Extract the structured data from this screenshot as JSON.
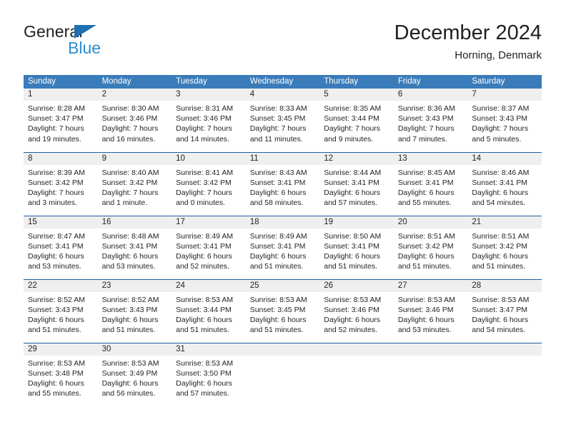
{
  "brand": {
    "line1": "General",
    "line2": "Blue",
    "accent_color": "#2d8ed0",
    "triangle_color": "#1f6fb2"
  },
  "header": {
    "title": "December 2024",
    "location": "Horning, Denmark"
  },
  "theme": {
    "header_blue": "#3a7cba",
    "row_divider_blue": "#1a5fa0",
    "daynum_band": "#efefef",
    "text": "#231f20"
  },
  "calendar": {
    "weekday_headers": [
      "Sunday",
      "Monday",
      "Tuesday",
      "Wednesday",
      "Thursday",
      "Friday",
      "Saturday"
    ],
    "weeks": [
      [
        {
          "day": "1",
          "lines": [
            "Sunrise: 8:28 AM",
            "Sunset: 3:47 PM",
            "Daylight: 7 hours",
            "and 19 minutes."
          ]
        },
        {
          "day": "2",
          "lines": [
            "Sunrise: 8:30 AM",
            "Sunset: 3:46 PM",
            "Daylight: 7 hours",
            "and 16 minutes."
          ]
        },
        {
          "day": "3",
          "lines": [
            "Sunrise: 8:31 AM",
            "Sunset: 3:46 PM",
            "Daylight: 7 hours",
            "and 14 minutes."
          ]
        },
        {
          "day": "4",
          "lines": [
            "Sunrise: 8:33 AM",
            "Sunset: 3:45 PM",
            "Daylight: 7 hours",
            "and 11 minutes."
          ]
        },
        {
          "day": "5",
          "lines": [
            "Sunrise: 8:35 AM",
            "Sunset: 3:44 PM",
            "Daylight: 7 hours",
            "and 9 minutes."
          ]
        },
        {
          "day": "6",
          "lines": [
            "Sunrise: 8:36 AM",
            "Sunset: 3:43 PM",
            "Daylight: 7 hours",
            "and 7 minutes."
          ]
        },
        {
          "day": "7",
          "lines": [
            "Sunrise: 8:37 AM",
            "Sunset: 3:43 PM",
            "Daylight: 7 hours",
            "and 5 minutes."
          ]
        }
      ],
      [
        {
          "day": "8",
          "lines": [
            "Sunrise: 8:39 AM",
            "Sunset: 3:42 PM",
            "Daylight: 7 hours",
            "and 3 minutes."
          ]
        },
        {
          "day": "9",
          "lines": [
            "Sunrise: 8:40 AM",
            "Sunset: 3:42 PM",
            "Daylight: 7 hours",
            "and 1 minute."
          ]
        },
        {
          "day": "10",
          "lines": [
            "Sunrise: 8:41 AM",
            "Sunset: 3:42 PM",
            "Daylight: 7 hours",
            "and 0 minutes."
          ]
        },
        {
          "day": "11",
          "lines": [
            "Sunrise: 8:43 AM",
            "Sunset: 3:41 PM",
            "Daylight: 6 hours",
            "and 58 minutes."
          ]
        },
        {
          "day": "12",
          "lines": [
            "Sunrise: 8:44 AM",
            "Sunset: 3:41 PM",
            "Daylight: 6 hours",
            "and 57 minutes."
          ]
        },
        {
          "day": "13",
          "lines": [
            "Sunrise: 8:45 AM",
            "Sunset: 3:41 PM",
            "Daylight: 6 hours",
            "and 55 minutes."
          ]
        },
        {
          "day": "14",
          "lines": [
            "Sunrise: 8:46 AM",
            "Sunset: 3:41 PM",
            "Daylight: 6 hours",
            "and 54 minutes."
          ]
        }
      ],
      [
        {
          "day": "15",
          "lines": [
            "Sunrise: 8:47 AM",
            "Sunset: 3:41 PM",
            "Daylight: 6 hours",
            "and 53 minutes."
          ]
        },
        {
          "day": "16",
          "lines": [
            "Sunrise: 8:48 AM",
            "Sunset: 3:41 PM",
            "Daylight: 6 hours",
            "and 53 minutes."
          ]
        },
        {
          "day": "17",
          "lines": [
            "Sunrise: 8:49 AM",
            "Sunset: 3:41 PM",
            "Daylight: 6 hours",
            "and 52 minutes."
          ]
        },
        {
          "day": "18",
          "lines": [
            "Sunrise: 8:49 AM",
            "Sunset: 3:41 PM",
            "Daylight: 6 hours",
            "and 51 minutes."
          ]
        },
        {
          "day": "19",
          "lines": [
            "Sunrise: 8:50 AM",
            "Sunset: 3:41 PM",
            "Daylight: 6 hours",
            "and 51 minutes."
          ]
        },
        {
          "day": "20",
          "lines": [
            "Sunrise: 8:51 AM",
            "Sunset: 3:42 PM",
            "Daylight: 6 hours",
            "and 51 minutes."
          ]
        },
        {
          "day": "21",
          "lines": [
            "Sunrise: 8:51 AM",
            "Sunset: 3:42 PM",
            "Daylight: 6 hours",
            "and 51 minutes."
          ]
        }
      ],
      [
        {
          "day": "22",
          "lines": [
            "Sunrise: 8:52 AM",
            "Sunset: 3:43 PM",
            "Daylight: 6 hours",
            "and 51 minutes."
          ]
        },
        {
          "day": "23",
          "lines": [
            "Sunrise: 8:52 AM",
            "Sunset: 3:43 PM",
            "Daylight: 6 hours",
            "and 51 minutes."
          ]
        },
        {
          "day": "24",
          "lines": [
            "Sunrise: 8:53 AM",
            "Sunset: 3:44 PM",
            "Daylight: 6 hours",
            "and 51 minutes."
          ]
        },
        {
          "day": "25",
          "lines": [
            "Sunrise: 8:53 AM",
            "Sunset: 3:45 PM",
            "Daylight: 6 hours",
            "and 51 minutes."
          ]
        },
        {
          "day": "26",
          "lines": [
            "Sunrise: 8:53 AM",
            "Sunset: 3:46 PM",
            "Daylight: 6 hours",
            "and 52 minutes."
          ]
        },
        {
          "day": "27",
          "lines": [
            "Sunrise: 8:53 AM",
            "Sunset: 3:46 PM",
            "Daylight: 6 hours",
            "and 53 minutes."
          ]
        },
        {
          "day": "28",
          "lines": [
            "Sunrise: 8:53 AM",
            "Sunset: 3:47 PM",
            "Daylight: 6 hours",
            "and 54 minutes."
          ]
        }
      ],
      [
        {
          "day": "29",
          "lines": [
            "Sunrise: 8:53 AM",
            "Sunset: 3:48 PM",
            "Daylight: 6 hours",
            "and 55 minutes."
          ]
        },
        {
          "day": "30",
          "lines": [
            "Sunrise: 8:53 AM",
            "Sunset: 3:49 PM",
            "Daylight: 6 hours",
            "and 56 minutes."
          ]
        },
        {
          "day": "31",
          "lines": [
            "Sunrise: 8:53 AM",
            "Sunset: 3:50 PM",
            "Daylight: 6 hours",
            "and 57 minutes."
          ]
        },
        {
          "day": "",
          "lines": []
        },
        {
          "day": "",
          "lines": []
        },
        {
          "day": "",
          "lines": []
        },
        {
          "day": "",
          "lines": []
        }
      ]
    ]
  }
}
